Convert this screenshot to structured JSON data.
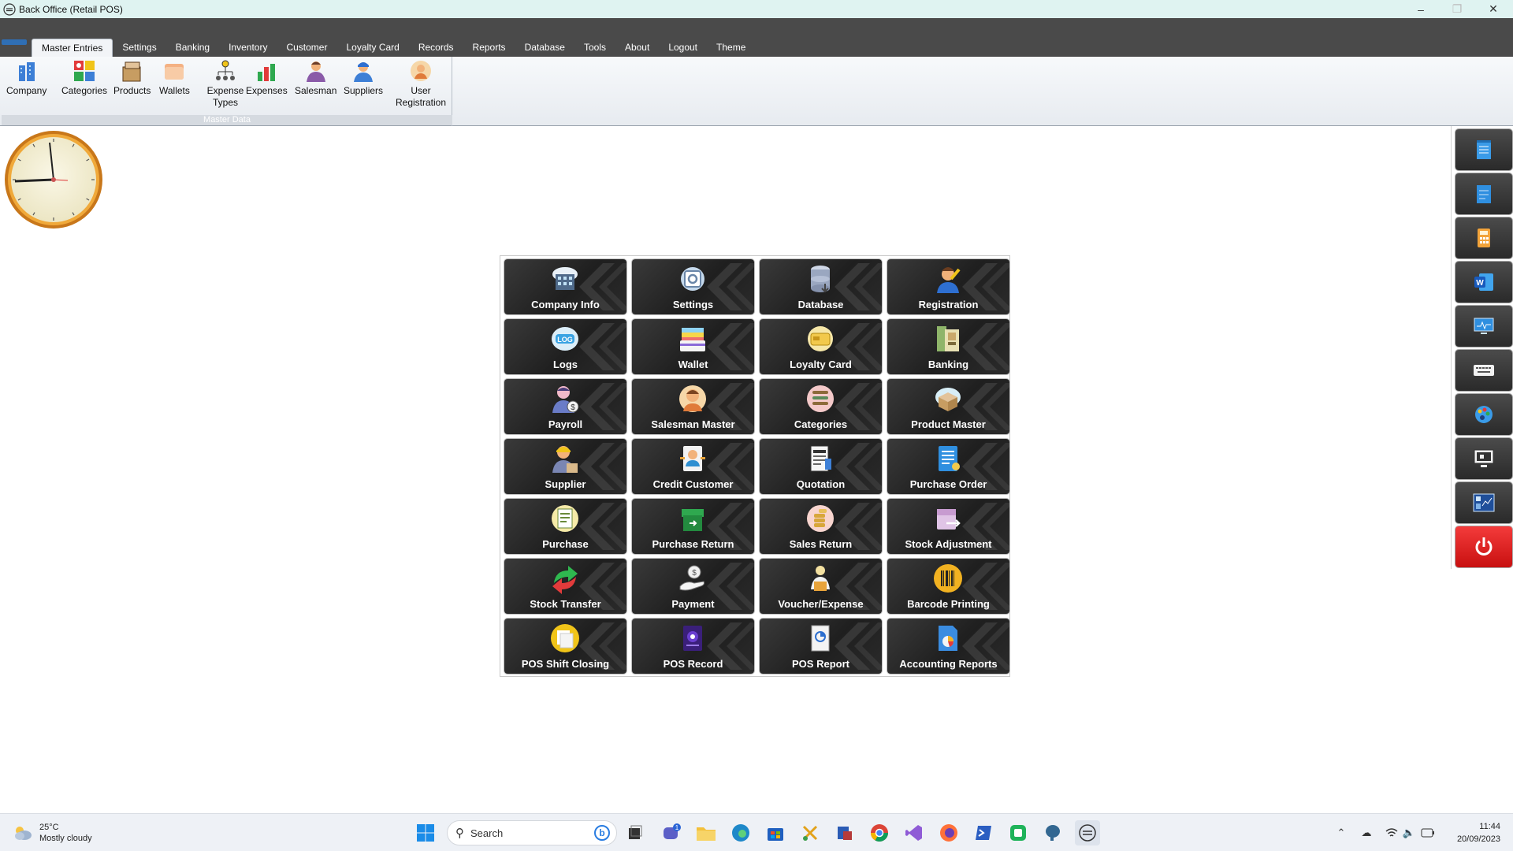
{
  "window": {
    "title": "Back Office (Retail POS)"
  },
  "menu": {
    "tabs": [
      "Master Entries",
      "Settings",
      "Banking",
      "Inventory",
      "Customer",
      "Loyalty Card",
      "Records",
      "Reports",
      "Database",
      "Tools",
      "About",
      "Logout",
      "Theme"
    ],
    "active_tab": "Master Entries"
  },
  "ribbon": {
    "group_label": "Master Data",
    "buttons": [
      {
        "label": "Company",
        "icon": "building-icon"
      },
      {
        "label": "Categories",
        "icon": "categories-icon"
      },
      {
        "label": "Products",
        "icon": "products-box-icon"
      },
      {
        "label": "Wallets",
        "icon": "wallet-icon"
      },
      {
        "label": "Expense Types",
        "icon": "expense-types-icon"
      },
      {
        "label": "Expenses",
        "icon": "expenses-chart-icon"
      },
      {
        "label": "Salesman",
        "icon": "salesman-icon"
      },
      {
        "label": "Suppliers",
        "icon": "supplier-icon"
      },
      {
        "label": "User Registration",
        "icon": "user-registration-icon"
      }
    ]
  },
  "tiles": [
    {
      "label": "Company Info",
      "icon": "company-info-icon"
    },
    {
      "label": "Settings",
      "icon": "settings-icon"
    },
    {
      "label": "Database",
      "icon": "database-icon"
    },
    {
      "label": "Registration",
      "icon": "registration-icon"
    },
    {
      "label": "Logs",
      "icon": "logs-icon"
    },
    {
      "label": "Wallet",
      "icon": "wallet-icon"
    },
    {
      "label": "Loyalty Card",
      "icon": "loyalty-card-icon"
    },
    {
      "label": "Banking",
      "icon": "banking-icon"
    },
    {
      "label": "Payroll",
      "icon": "payroll-icon"
    },
    {
      "label": "Salesman Master",
      "icon": "salesman-icon"
    },
    {
      "label": "Categories",
      "icon": "categories-icon"
    },
    {
      "label": "Product Master",
      "icon": "product-master-icon"
    },
    {
      "label": "Supplier",
      "icon": "supplier-icon"
    },
    {
      "label": "Credit Customer",
      "icon": "credit-customer-icon"
    },
    {
      "label": "Quotation",
      "icon": "quotation-icon"
    },
    {
      "label": "Purchase Order",
      "icon": "purchase-order-icon"
    },
    {
      "label": "Purchase",
      "icon": "purchase-icon"
    },
    {
      "label": "Purchase Return",
      "icon": "purchase-return-icon"
    },
    {
      "label": "Sales Return",
      "icon": "sales-return-icon"
    },
    {
      "label": "Stock Adjustment",
      "icon": "stock-adjustment-icon"
    },
    {
      "label": "Stock Transfer",
      "icon": "stock-transfer-icon"
    },
    {
      "label": "Payment",
      "icon": "payment-icon"
    },
    {
      "label": "Voucher/Expense",
      "icon": "voucher-icon"
    },
    {
      "label": "Barcode Printing",
      "icon": "barcode-icon"
    },
    {
      "label": "POS Shift Closing",
      "icon": "shift-closing-icon"
    },
    {
      "label": "POS Record",
      "icon": "pos-record-icon"
    },
    {
      "label": "POS Report",
      "icon": "pos-report-icon"
    },
    {
      "label": "Accounting Reports",
      "icon": "accounting-reports-icon"
    }
  ],
  "dock": [
    "notepad-icon",
    "notes-icon",
    "calculator-icon",
    "word-icon",
    "monitor-icon",
    "keyboard-icon",
    "paint-icon",
    "screen-icon",
    "dashboard-icon",
    "power-icon"
  ],
  "taskbar": {
    "weather_temp": "25°C",
    "weather_desc": "Mostly cloudy",
    "search_placeholder": "Search",
    "time": "11:44",
    "date": "20/09/2023",
    "chat_badge": "1"
  },
  "colors": {
    "tile_bg": "#2a2a2a",
    "menubar": "#4a4a4a",
    "titlebar": "#dff3f1",
    "power": "#e02020",
    "accent": "#2f6fb5"
  }
}
